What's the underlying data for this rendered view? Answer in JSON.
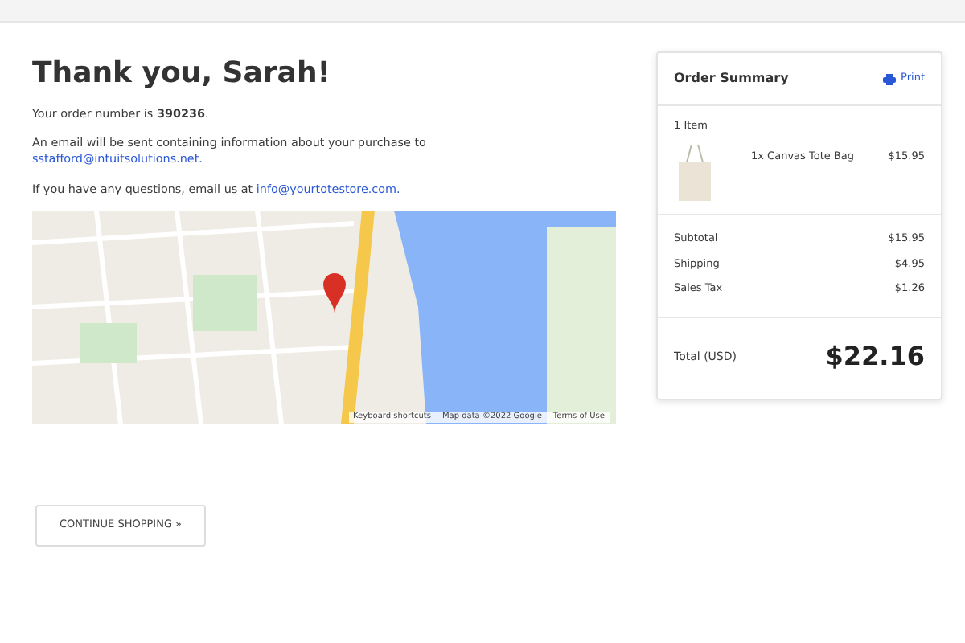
{
  "heading": "Thank you, Sarah!",
  "order_line": "Your order number is **390236**.",
  "email_line": "An email will be sent containing information about your purchase to",
  "email_link": "sstafford@intuitsolutions.net.",
  "question_line": "If you have any questions, email us at",
  "question_link": "info@yourtotestore.com.",
  "map": {
    "attribution": [
      "Keyboard shortcuts",
      "Map data ©2022 Google",
      "Terms of Use"
    ]
  },
  "continue_button": "CONTINUE SHOPPING »",
  "summary": {
    "title": "Order Summary",
    "print": "Print",
    "item_count": "1 Item",
    "items": [
      {
        "name": "1x Canvas Tote Bag",
        "price": "$15.95"
      }
    ],
    "lines": [
      {
        "label": "Subtotal",
        "value": "$15.95"
      },
      {
        "label": "Shipping",
        "value": "$4.95"
      },
      {
        "label": "Sales Tax",
        "value": "$1.26"
      }
    ],
    "total_label": "Total (USD)",
    "total": "$22.16"
  }
}
